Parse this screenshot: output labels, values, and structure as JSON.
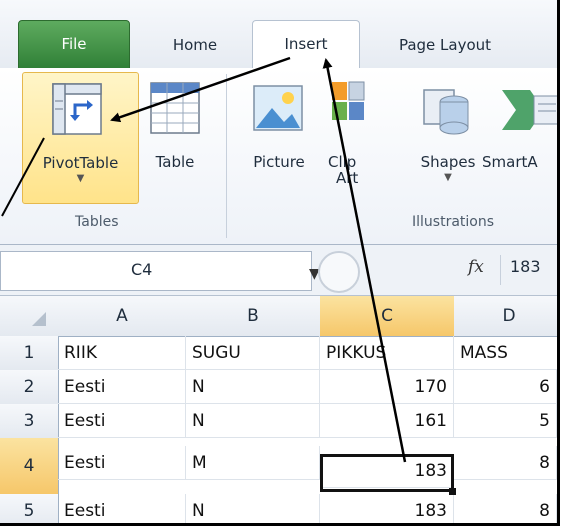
{
  "tabs": {
    "file": "File",
    "home": "Home",
    "insert": "Insert",
    "page_layout": "Page Layout"
  },
  "ribbon": {
    "tables_group": "Tables",
    "illustrations_group": "Illustrations",
    "pivottable": "PivotTable",
    "table": "Table",
    "picture": "Picture",
    "clip_art_1": "Clip",
    "clip_art_2": "Art",
    "shapes": "Shapes",
    "smartart": "SmartA"
  },
  "formula_bar": {
    "name_box": "C4",
    "fx": "fx",
    "value": "183"
  },
  "grid": {
    "columns": [
      "A",
      "B",
      "C",
      "D"
    ],
    "selected_column": "C",
    "selected_row": "4",
    "rows": [
      {
        "num": "1",
        "a": "RIIK",
        "b": "SUGU",
        "c": "PIKKUS",
        "d": "MASS"
      },
      {
        "num": "2",
        "a": "Eesti",
        "b": "N",
        "c": "170",
        "d": "6"
      },
      {
        "num": "3",
        "a": "Eesti",
        "b": "N",
        "c": "161",
        "d": "5"
      },
      {
        "num": "4",
        "a": "Eesti",
        "b": "M",
        "c": "183",
        "d": "8"
      },
      {
        "num": "5",
        "a": "Eesti",
        "b": "N",
        "c": "183",
        "d": "8"
      }
    ]
  },
  "colors": {
    "file_tab": "#3a8a3f",
    "selection_header": "#f6c76a",
    "pivot_highlight": "#ffe38a"
  }
}
